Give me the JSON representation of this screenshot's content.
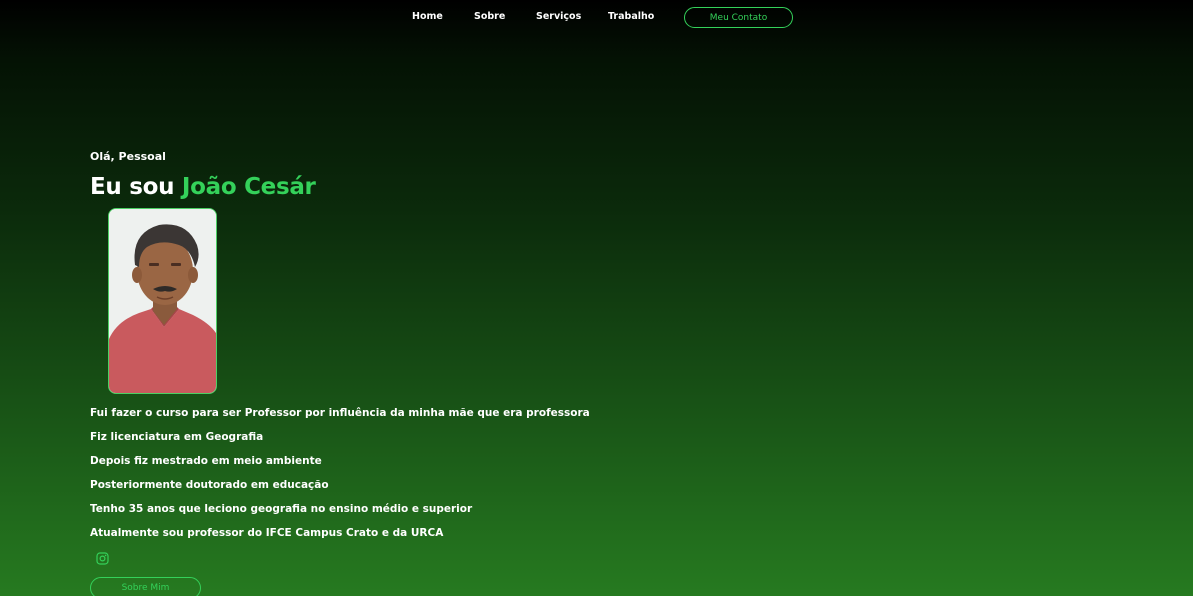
{
  "nav": {
    "items": [
      "Home",
      "Sobre",
      "Serviços",
      "Trabalho"
    ],
    "cta_label": "Meu Contato"
  },
  "hero": {
    "greeting": "Olá, Pessoal",
    "intro": "Eu sou ",
    "name": "João Cesár",
    "bio_lines": [
      "Fui fazer o curso para ser Professor por influência da minha mãe que era professora",
      "Fiz licenciatura em Geografia",
      "Depois fiz mestrado em meio ambiente",
      "Posteriormente doutorado em educação",
      "Tenho 35 anos que leciono geografia no ensino médio e superior",
      "Atualmente sou professor do IFCE Campus Crato e da URCA"
    ],
    "social_icon": "instagram-icon",
    "about_button_label": "Sobre Mim"
  },
  "colors": {
    "accent": "#34d15a",
    "text": "#ffffff",
    "background_top": "#000000",
    "background_bottom": "#267a20"
  }
}
